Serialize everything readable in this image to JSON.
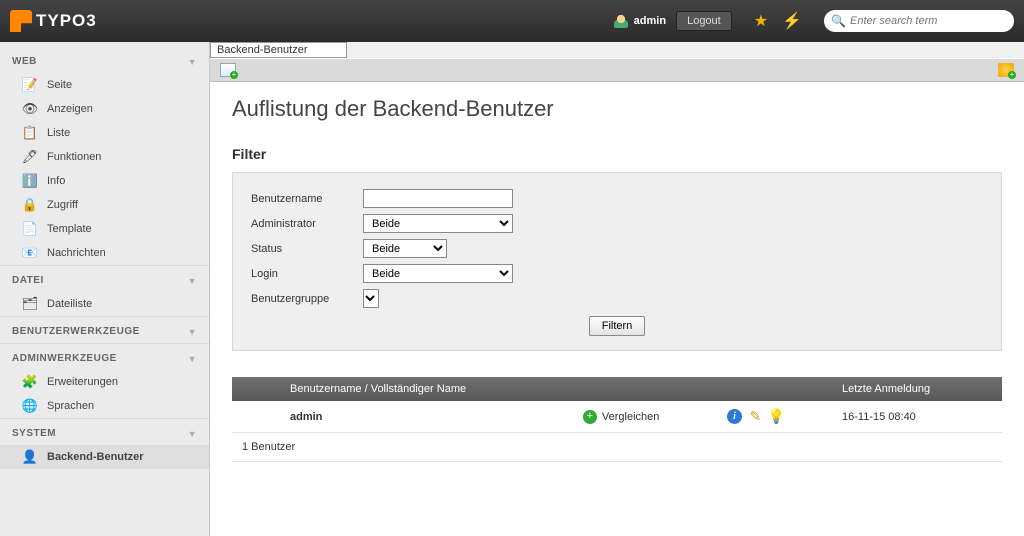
{
  "logo_text": "TYPO3",
  "top": {
    "user": "admin",
    "logout": "Logout",
    "search_placeholder": "Enter search term"
  },
  "sidebar": {
    "sections": [
      {
        "title": "WEB",
        "items": [
          {
            "icon": "📝",
            "label": "Seite"
          },
          {
            "icon": "👁",
            "label": "Anzeigen"
          },
          {
            "icon": "📋",
            "label": "Liste"
          },
          {
            "icon": "🖊",
            "label": "Funktionen"
          },
          {
            "icon": "ℹ️",
            "label": "Info"
          },
          {
            "icon": "🔒",
            "label": "Zugriff"
          },
          {
            "icon": "📄",
            "label": "Template"
          },
          {
            "icon": "📧",
            "label": "Nachrichten"
          }
        ]
      },
      {
        "title": "DATEI",
        "items": [
          {
            "icon": "🗂",
            "label": "Dateiliste"
          }
        ]
      },
      {
        "title": "BENUTZERWERKZEUGE",
        "items": []
      },
      {
        "title": "ADMINWERKZEUGE",
        "items": [
          {
            "icon": "🧩",
            "label": "Erweiterungen"
          },
          {
            "icon": "🌐",
            "label": "Sprachen"
          }
        ]
      },
      {
        "title": "SYSTEM",
        "items": [
          {
            "icon": "👤",
            "label": "Backend-Benutzer",
            "active": true
          }
        ]
      }
    ]
  },
  "crumbs_select": "Backend-Benutzer",
  "page": {
    "title": "Auflistung der Backend-Benutzer",
    "filter_heading": "Filter",
    "filter": {
      "labels": {
        "username": "Benutzername",
        "admin": "Administrator",
        "status": "Status",
        "login": "Login",
        "group": "Benutzergruppe"
      },
      "values": {
        "username": "",
        "admin": "Beide",
        "status": "Beide",
        "login": "Beide"
      },
      "button": "Filtern"
    },
    "table": {
      "head": {
        "col1": "",
        "col2": "Benutzername / Vollständiger Name",
        "col3": "",
        "col4": "",
        "col5": "Letzte Anmeldung"
      },
      "rows": [
        {
          "username": "admin",
          "compare": "Vergleichen",
          "last_login": "16-11-15 08:40"
        }
      ],
      "count": "1 Benutzer"
    }
  }
}
